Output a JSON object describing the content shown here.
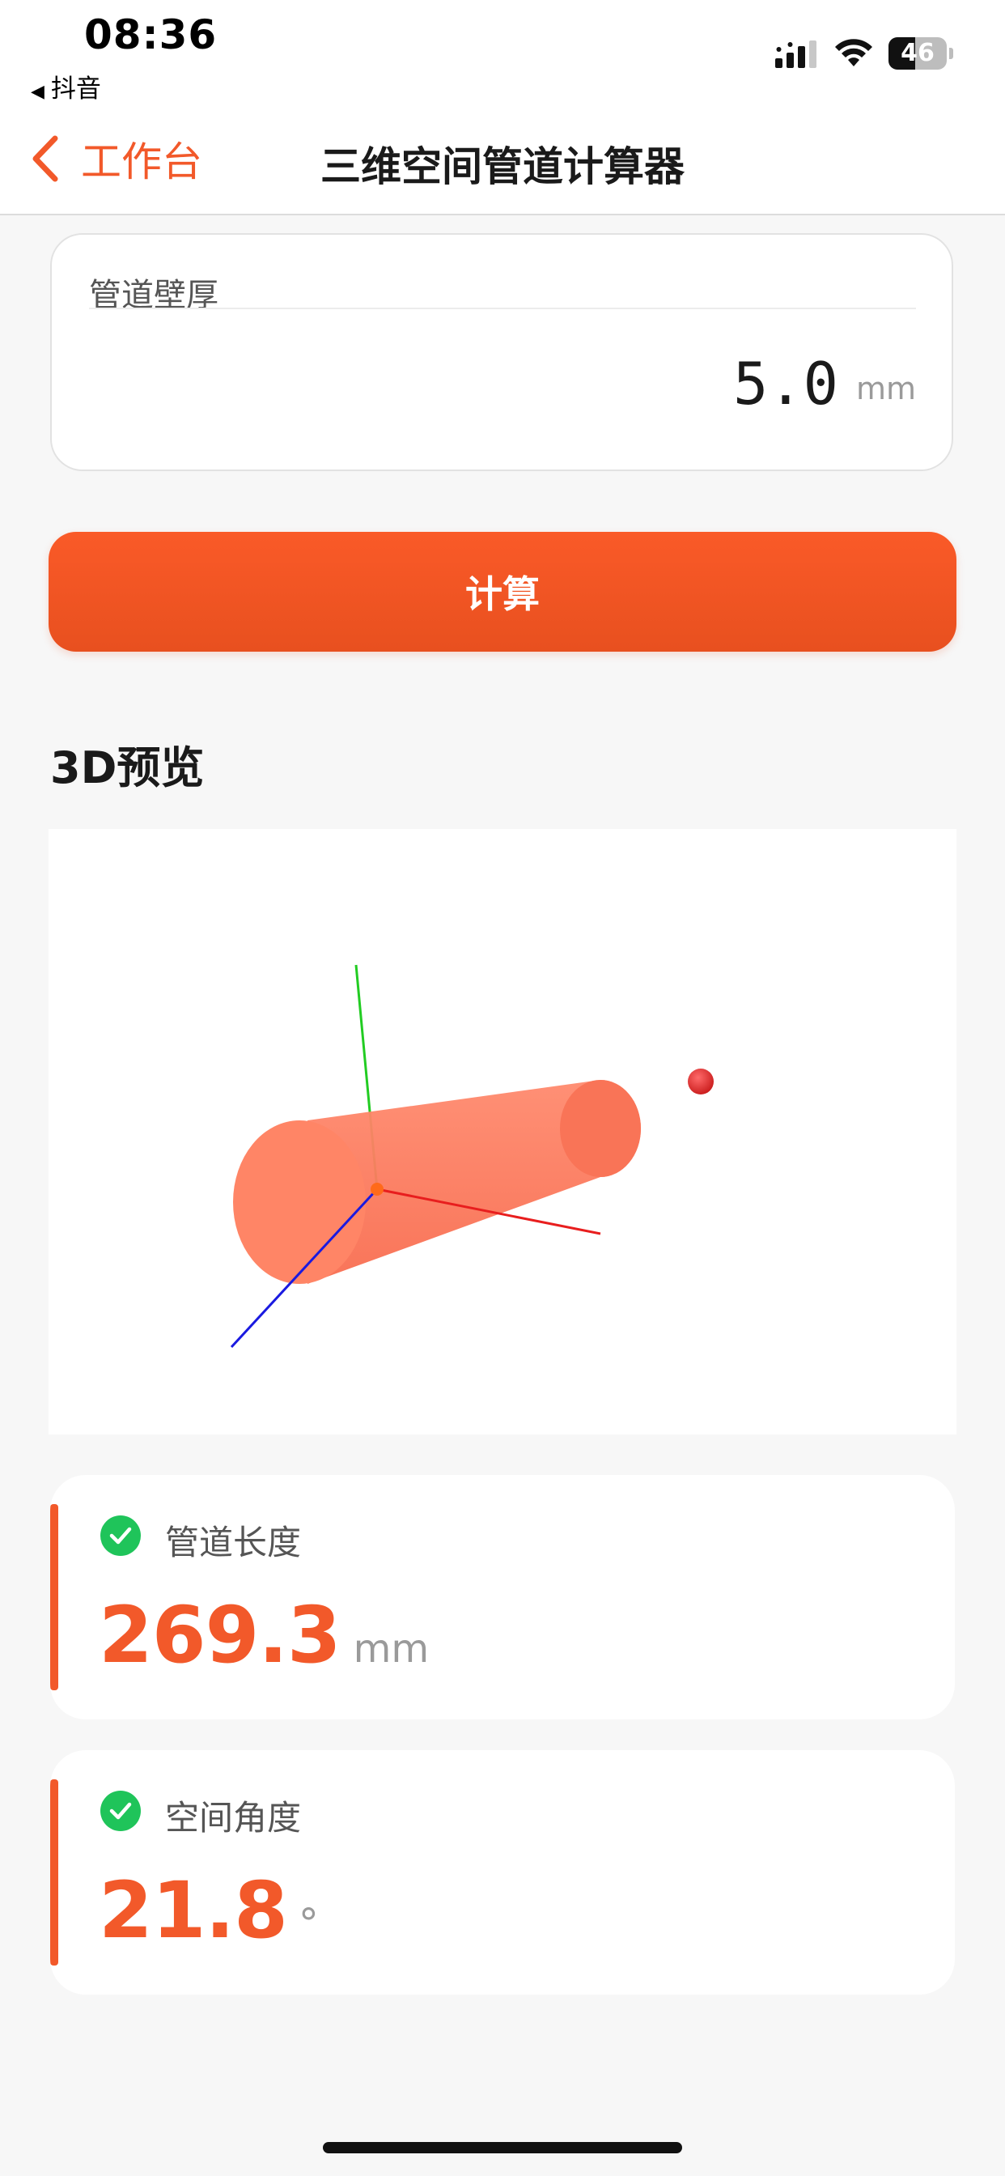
{
  "status_bar": {
    "time": "08:36",
    "back_app_label": "抖音",
    "battery_level": "46",
    "battery_fraction": 0.46
  },
  "nav": {
    "back_label": "工作台",
    "title": "三维空间管道计算器",
    "accent_color": "#f2592a"
  },
  "wall_thickness": {
    "label": "管道壁厚",
    "value": "5.0",
    "unit": "mm"
  },
  "calculate_button": {
    "label": "计算",
    "color": "#f2592a"
  },
  "preview": {
    "title": "3D预览",
    "pipe_color": "#ff7a5c",
    "x_axis_color": "#e81e1e",
    "y_axis_color": "#22cc22",
    "z_axis_color": "#1a1ae0",
    "target_point_color": "#e02a2a"
  },
  "results": {
    "pipe_length": {
      "label": "管道长度",
      "value": "269.3",
      "unit": "mm"
    },
    "space_angle": {
      "label": "空间角度",
      "value": "21.8",
      "unit": "°"
    }
  }
}
